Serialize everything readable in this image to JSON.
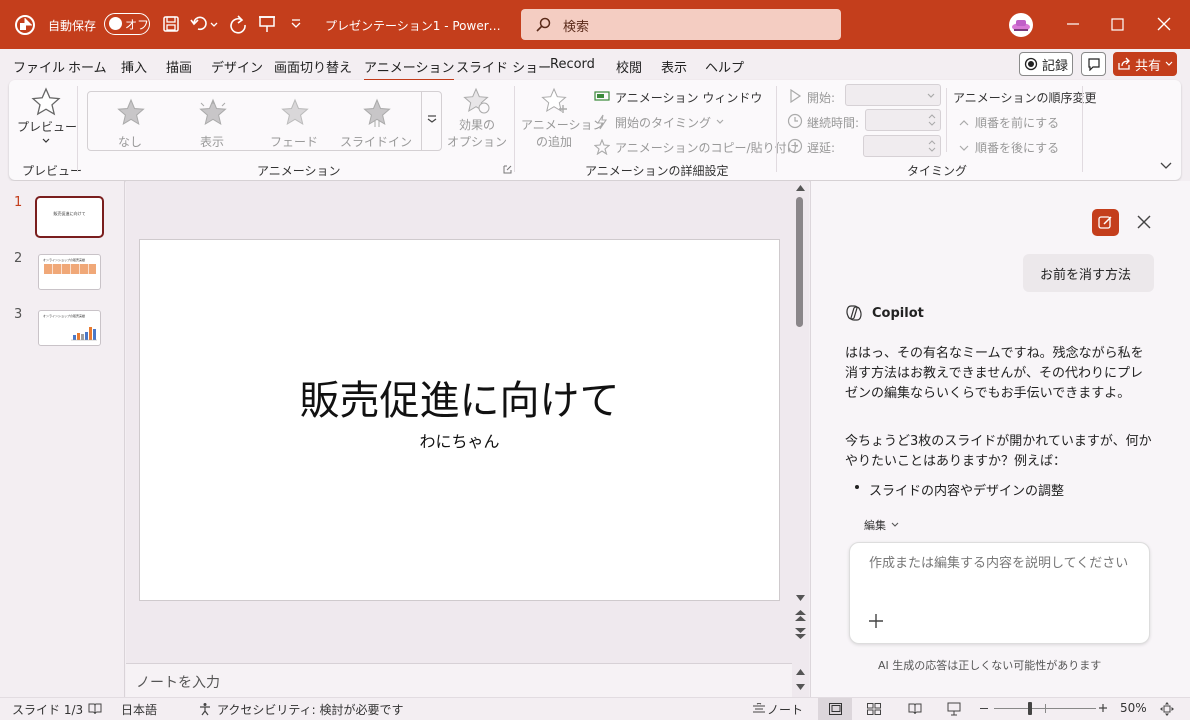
{
  "titlebar": {
    "autosave_label": "自動保存",
    "autosave_state": "オフ",
    "doc_title": "プレゼンテーション1 - Power…",
    "search_placeholder": "検索"
  },
  "tabs": [
    {
      "label": "ファイル"
    },
    {
      "label": "ホーム"
    },
    {
      "label": "挿入"
    },
    {
      "label": "描画"
    },
    {
      "label": "デザイン"
    },
    {
      "label": "画面切り替え"
    },
    {
      "label": "アニメーション"
    },
    {
      "label": "スライド ショー"
    },
    {
      "label": "Record"
    },
    {
      "label": "校閲"
    },
    {
      "label": "表示"
    },
    {
      "label": "ヘルプ"
    }
  ],
  "tab_buttons": {
    "record": "記録",
    "share": "共有"
  },
  "ribbon": {
    "preview_label": "プレビュー",
    "preview_group": "プレビュー",
    "gallery": [
      "なし",
      "表示",
      "フェード",
      "スライドイン"
    ],
    "effect_options": [
      "効果の",
      "オプション"
    ],
    "animation_group": "アニメーション",
    "add_animation": [
      "アニメーション",
      "の追加"
    ],
    "animation_window": "アニメーション ウィンドウ",
    "trigger": "開始のタイミング",
    "painter": "アニメーションのコピー/貼り付け",
    "advanced_group": "アニメーションの詳細設定",
    "start_label": "開始:",
    "duration_label": "継続時間:",
    "delay_label": "遅延:",
    "reorder_label": "アニメーションの順序変更",
    "move_earlier": "順番を前にする",
    "move_later": "順番を後にする",
    "timing_group": "タイミング"
  },
  "slides": [
    {
      "number": "1",
      "title": "販売促進に向けて"
    },
    {
      "number": "2",
      "title": "オンラインショップの販売実績"
    },
    {
      "number": "3",
      "title": "オンラインショップの販売実績"
    }
  ],
  "editor": {
    "slide_title": "販売促進に向けて",
    "slide_subtitle": "わにちゃん",
    "notes_placeholder": "ノートを入力"
  },
  "copilot": {
    "user_message": "お前を消す方法",
    "name": "Copilot",
    "reply_p1": "ははっ、その有名なミームですね。残念ながら私を消す方法はお教えできませんが、その代わりにプレゼンの編集ならいくらでもお手伝いできますよ。",
    "reply_p2": "今ちょうど3枚のスライドが開かれていますが、何かやりたいことはありますか？例えば：",
    "bullet1": "スライドの内容やデザインの調整",
    "mode_label": "編集",
    "input_placeholder": "作成または編集する内容を説明してください",
    "disclaimer": "AI 生成の応答は正しくない可能性があります"
  },
  "status": {
    "slide_info": "スライド 1/3",
    "language": "日本語",
    "accessibility": "アクセシビリティ: 検討が必要です",
    "notes": "ノート",
    "zoom": "50%",
    "zoom_level": 0.5
  },
  "colors": {
    "accent": "#c43e1c",
    "search_bg": "#f4cdc2",
    "selected_thumb": "#7a1e1e",
    "status_bar": "#f3eef2"
  }
}
